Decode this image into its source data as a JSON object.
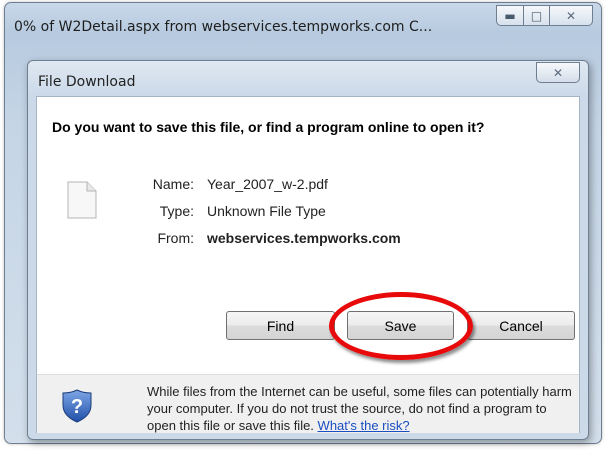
{
  "outer_window": {
    "title": "0% of W2Detail.aspx from webservices.tempworks.com C..."
  },
  "dialog": {
    "title": "File Download",
    "question": "Do you want to save this file, or find a program online to open it?",
    "file": {
      "name_label": "Name:",
      "name_value": "Year_2007_w-2.pdf",
      "type_label": "Type:",
      "type_value": "Unknown File Type",
      "from_label": "From:",
      "from_value": "webservices.tempworks.com"
    },
    "buttons": {
      "find": "Find",
      "save": "Save",
      "cancel": "Cancel"
    },
    "footer": {
      "warning_text": "While files from the Internet can be useful, some files can potentially harm your computer. If you do not trust the source, do not find a program to open this file or save this file.",
      "link_text": "What's the risk?"
    }
  },
  "annotation": {
    "highlight_color": "#e80a0a"
  }
}
